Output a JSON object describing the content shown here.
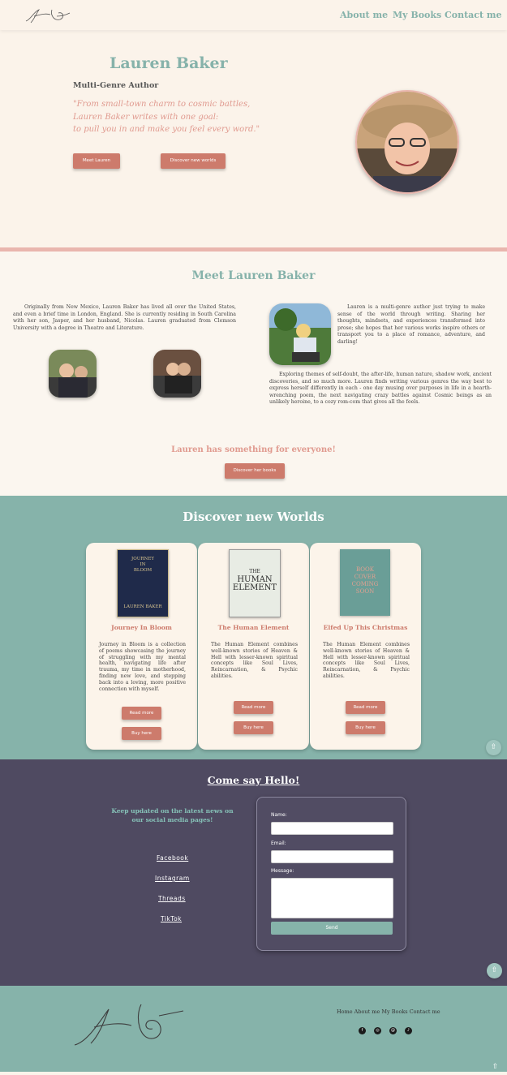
{
  "header": {
    "logo_text": "Lauren Baker",
    "nav": [
      "About me",
      "My Books",
      "Contact me"
    ]
  },
  "hero": {
    "name": "Lauren Baker",
    "subtitle": "Multi-Genre Author",
    "quote_lines": [
      "\"From small-town charm to cosmic battles,",
      "Lauren Baker writes with one goal:",
      "to pull you in and make you feel every word.\""
    ],
    "buttons": [
      "Meet Lauren",
      "Discover new worlds"
    ]
  },
  "about": {
    "title": "Meet Lauren Baker",
    "left_para": "Originally from New Mexico, Lauren Baker has lived all over the United States, and even a brief time in London, England. She is currently residing in South Carolina with her son, Jasper, and her husband, Nicolas. Lauren graduated from Clemson University with a degree in Theatre and Literature.",
    "right_para1": "Lauren is a multi-genre author just trying to make sense of the world through writing. Sharing her thoughts, mindsets, and experiences transformed into prose; she hopes that her various works inspire others or transport you to a place of romance, adventure, and darling!",
    "right_para2": "Exploring themes of self-doubt, the after-life, human nature, shadow work, ancient discoveries, and so much more. Lauren finds writing various genres the way best to express herself differently in each - one day musing over purposes in life in a hearth-wrenching poem, the next navigating crazy battles against Cosmic beings as an unlikely heroine, to a cozy rom-com that gives all the feels.",
    "tagline": "Lauren has something for everyone!",
    "button": "Discover her books"
  },
  "books": {
    "title": "Discover new Worlds",
    "items": [
      {
        "cover_lines": [
          "JOURNEY",
          "IN",
          "BLOOM",
          "LAUREN BAKER"
        ],
        "title": "Journey In Bloom",
        "desc": "Journey in Bloom is a collection of poems showcasing the journey of struggling with my mental health, navigating life after trauma, my time in motherhood, finding new love, and stepping back into a loving, more positive connection with myself.",
        "read": "Read more",
        "buy": "Buy here"
      },
      {
        "cover_lines": [
          "THE",
          "HUMAN",
          "ELEMENT"
        ],
        "title": "The Human Element",
        "desc": "The Human Element combines well-known stories of Heaven & Hell with lesser-known spiritual concepts like Soul Lives, Reincarnation, & Psychic abilities.",
        "read": "Read more",
        "buy": "Buy here"
      },
      {
        "cover_lines": [
          "BOOK",
          "COVER",
          "COMING",
          "SOON"
        ],
        "title": "Elfed Up This Christmas",
        "desc": "The Human Element combines well-known stories of Heaven & Hell with lesser-known spiritual concepts like Soul Lives, Reincarnation, & Psychic abilities.",
        "read": "Read more",
        "buy": "Buy here"
      }
    ]
  },
  "contact": {
    "title": "Come say Hello!",
    "social_blurb": "Keep updated on the latest news on our social media pages!",
    "social_links": [
      "Facebook",
      "Instagram",
      "Threads",
      "TikTok"
    ],
    "form": {
      "name_label": "Name:",
      "email_label": "Email:",
      "message_label": "Message:",
      "send": "Send"
    }
  },
  "footer": {
    "logo_text": "Lauren Baker",
    "links": "Home About me My Books Contact me",
    "social_icons": [
      "facebook-icon",
      "instagram-icon",
      "threads-icon",
      "tiktok-icon"
    ]
  },
  "scroll_top": "⇧",
  "colors": {
    "teal": "#86b3aa",
    "coral": "#cd7b6c",
    "cream": "#fbf3ea",
    "purple": "#4f4a61",
    "pink": "#e9b6ae"
  }
}
